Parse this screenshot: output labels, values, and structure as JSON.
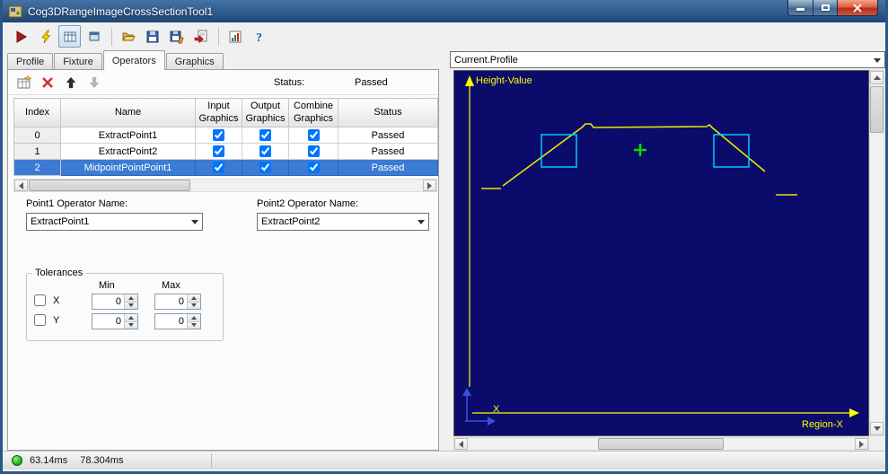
{
  "window": {
    "title": "Cog3DRangeImageCrossSectionTool1"
  },
  "tabs": [
    {
      "label": "Profile"
    },
    {
      "label": "Fixture"
    },
    {
      "label": "Operators"
    },
    {
      "label": "Graphics"
    }
  ],
  "operators": {
    "status_label": "Status:",
    "status_value": "Passed",
    "table": {
      "columns": [
        "Index",
        "Name",
        "Input Graphics",
        "Output Graphics",
        "Combine Graphics",
        "Status"
      ],
      "rows": [
        {
          "index": "0",
          "name": "ExtractPoint1",
          "input_graphics": true,
          "output_graphics": true,
          "combine_graphics": true,
          "status": "Passed",
          "selected": false
        },
        {
          "index": "1",
          "name": "ExtractPoint2",
          "input_graphics": true,
          "output_graphics": true,
          "combine_graphics": true,
          "status": "Passed",
          "selected": false
        },
        {
          "index": "2",
          "name": "MidpointPointPoint1",
          "input_graphics": true,
          "output_graphics": true,
          "combine_graphics": true,
          "status": "Passed",
          "selected": true
        }
      ]
    },
    "point1_label": "Point1 Operator Name:",
    "point1_value": "ExtractPoint1",
    "point2_label": "Point2 Operator Name:",
    "point2_value": "ExtractPoint2",
    "tolerances": {
      "legend": "Tolerances",
      "min_header": "Min",
      "max_header": "Max",
      "rows": [
        {
          "label": "X",
          "min": "0",
          "max": "0"
        },
        {
          "label": "Y",
          "min": "0",
          "max": "0"
        }
      ]
    }
  },
  "profile_panel": {
    "selector_value": "Current.Profile",
    "display": {
      "background": "#0b0b6b",
      "line_color": "#e8e800",
      "axis_color": "#ffff00",
      "region_color": "#00ccff",
      "marker_color": "#00dd00",
      "origin_axes_color": "#3c50e0",
      "y_axis_label": "Height-Value",
      "x_axis_label": "Region-X",
      "origin_label": "X",
      "profile_main": "54,128 142,63 146,59 152,59 155,63 281,62 284,60 287,63 346,112",
      "profile_dash_left": "30,131 52,131",
      "profile_dash_right": "358,138 382,138",
      "search_region_1": "97,71 136,71 136,107 97,107",
      "search_region_2": "289,71 328,71 328,107 289,107",
      "marker_h": "200,88 214,88",
      "marker_v": "207,81 207,95"
    }
  },
  "statusbar": {
    "time1": "63.14ms",
    "time2": "78.304ms"
  },
  "colors": {
    "selection": "#3b7bd4",
    "status_led": "#27b427"
  }
}
